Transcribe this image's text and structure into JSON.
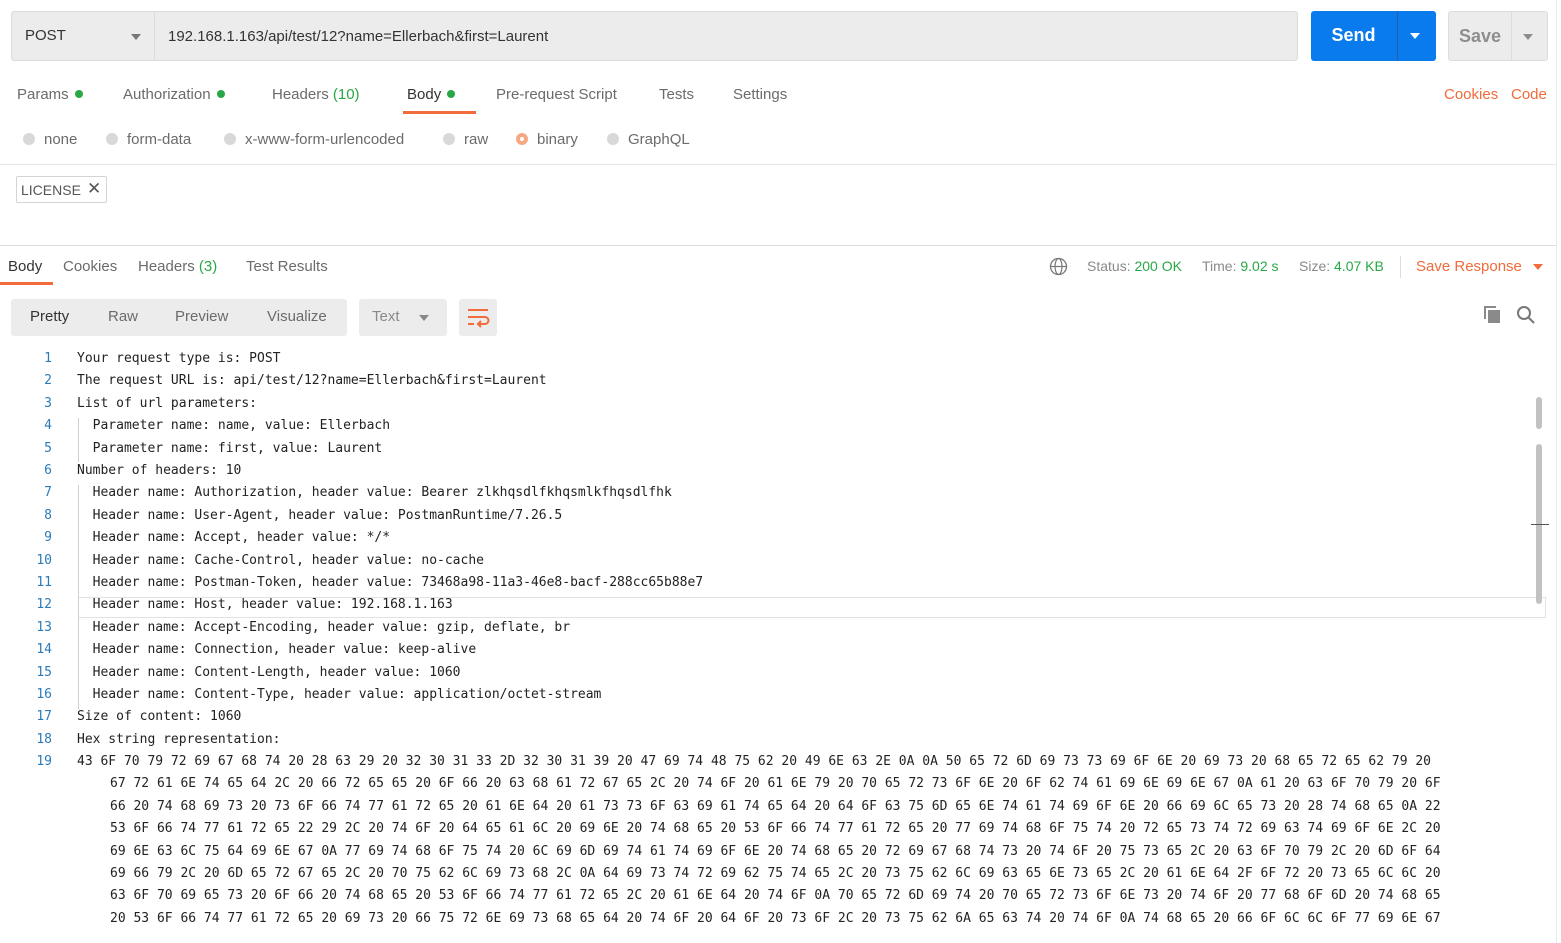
{
  "request": {
    "method": "POST",
    "url": "192.168.1.163/api/test/12?name=Ellerbach&first=Laurent",
    "send_label": "Send",
    "save_label": "Save"
  },
  "request_tabs": [
    {
      "label": "Params",
      "dot": true
    },
    {
      "label": "Authorization",
      "dot": true
    },
    {
      "label": "Headers",
      "count": "(10)"
    },
    {
      "label": "Body",
      "dot": true,
      "active": true
    },
    {
      "label": "Pre-request Script"
    },
    {
      "label": "Tests"
    },
    {
      "label": "Settings"
    }
  ],
  "right_links": {
    "cookies": "Cookies",
    "code": "Code"
  },
  "body_types": [
    {
      "label": "none"
    },
    {
      "label": "form-data"
    },
    {
      "label": "x-www-form-urlencoded"
    },
    {
      "label": "raw"
    },
    {
      "label": "binary",
      "selected": true
    },
    {
      "label": "GraphQL"
    }
  ],
  "binary_file": {
    "name": "LICENSE",
    "remove": "✕"
  },
  "response_tabs": [
    {
      "label": "Body",
      "active": true
    },
    {
      "label": "Cookies"
    },
    {
      "label": "Headers",
      "count": "(3)"
    },
    {
      "label": "Test Results"
    }
  ],
  "response_meta": {
    "status_label": "Status:",
    "status_value": "200 OK",
    "time_label": "Time:",
    "time_value": "9.02 s",
    "size_label": "Size:",
    "size_value": "4.07 KB",
    "save_response": "Save Response"
  },
  "view_modes": [
    "Pretty",
    "Raw",
    "Preview",
    "Visualize"
  ],
  "format": "Text",
  "icons": {
    "globe": "globe-icon",
    "copy": "copy-icon",
    "search": "search-icon",
    "wrap": "wrap-lines-icon"
  },
  "colors": {
    "accent": "#f26b3a",
    "send": "#097bed",
    "success": "#28a745",
    "line_number": "#2b7bb9"
  },
  "lines": [
    "Your request type is: POST",
    "The request URL is: api/test/12?name=Ellerbach&first=Laurent",
    "List of url parameters:",
    "  Parameter name: name, value: Ellerbach",
    "  Parameter name: first, value: Laurent",
    "Number of headers: 10",
    "  Header name: Authorization, header value: Bearer zlkhqsdlfkhqsmlkfhqsdlfhk",
    "  Header name: User-Agent, header value: PostmanRuntime/7.26.5",
    "  Header name: Accept, header value: */*",
    "  Header name: Cache-Control, header value: no-cache",
    "  Header name: Postman-Token, header value: 73468a98-11a3-46e8-bacf-288cc65b88e7",
    "  Header name: Host, header value: 192.168.1.163",
    "  Header name: Accept-Encoding, header value: gzip, deflate, br",
    "  Header name: Connection, header value: keep-alive",
    "  Header name: Content-Length, header value: 1060",
    "  Header name: Content-Type, header value: application/octet-stream",
    "Size of content: 1060",
    "Hex string representation:"
  ],
  "hex_first": "43 6F 70 79 72 69 67 68 74 20 28 63 29 20 32 30 31 33 2D 32 30 31 39 20 47 69 74 48 75 62 20 49 6E 63 2E 0A 0A 50 65 72 6D 69 73 73 69 6F 6E 20 69 73 20 68 65 72 65 62 79 20",
  "hex_wrapped": [
    "67 72 61 6E 74 65 64 2C 20 66 72 65 65 20 6F 66 20 63 68 61 72 67 65 2C 20 74 6F 20 61 6E 79 20 70 65 72 73 6F 6E 20 6F 62 74 61 69 6E 69 6E 67 0A 61 20 63 6F 70 79 20 6F",
    "66 20 74 68 69 73 20 73 6F 66 74 77 61 72 65 20 61 6E 64 20 61 73 73 6F 63 69 61 74 65 64 20 64 6F 63 75 6D 65 6E 74 61 74 69 6F 6E 20 66 69 6C 65 73 20 28 74 68 65 0A 22",
    "53 6F 66 74 77 61 72 65 22 29 2C 20 74 6F 20 64 65 61 6C 20 69 6E 20 74 68 65 20 53 6F 66 74 77 61 72 65 20 77 69 74 68 6F 75 74 20 72 65 73 74 72 69 63 74 69 6F 6E 2C 20",
    "69 6E 63 6C 75 64 69 6E 67 0A 77 69 74 68 6F 75 74 20 6C 69 6D 69 74 61 74 69 6F 6E 20 74 68 65 20 72 69 67 68 74 73 20 74 6F 20 75 73 65 2C 20 63 6F 70 79 2C 20 6D 6F 64",
    "69 66 79 2C 20 6D 65 72 67 65 2C 20 70 75 62 6C 69 73 68 2C 0A 64 69 73 74 72 69 62 75 74 65 2C 20 73 75 62 6C 69 63 65 6E 73 65 2C 20 61 6E 64 2F 6F 72 20 73 65 6C 6C 20",
    "63 6F 70 69 65 73 20 6F 66 20 74 68 65 20 53 6F 66 74 77 61 72 65 2C 20 61 6E 64 20 74 6F 0A 70 65 72 6D 69 74 20 70 65 72 73 6F 6E 73 20 74 6F 20 77 68 6F 6D 20 74 68 65",
    "20 53 6F 66 74 77 61 72 65 20 69 73 20 66 75 72 6E 69 73 68 65 64 20 74 6F 20 64 6F 20 73 6F 2C 20 73 75 62 6A 65 63 74 20 74 6F 0A 74 68 65 20 66 6F 6C 6C 6F 77 69 6E 67"
  ]
}
